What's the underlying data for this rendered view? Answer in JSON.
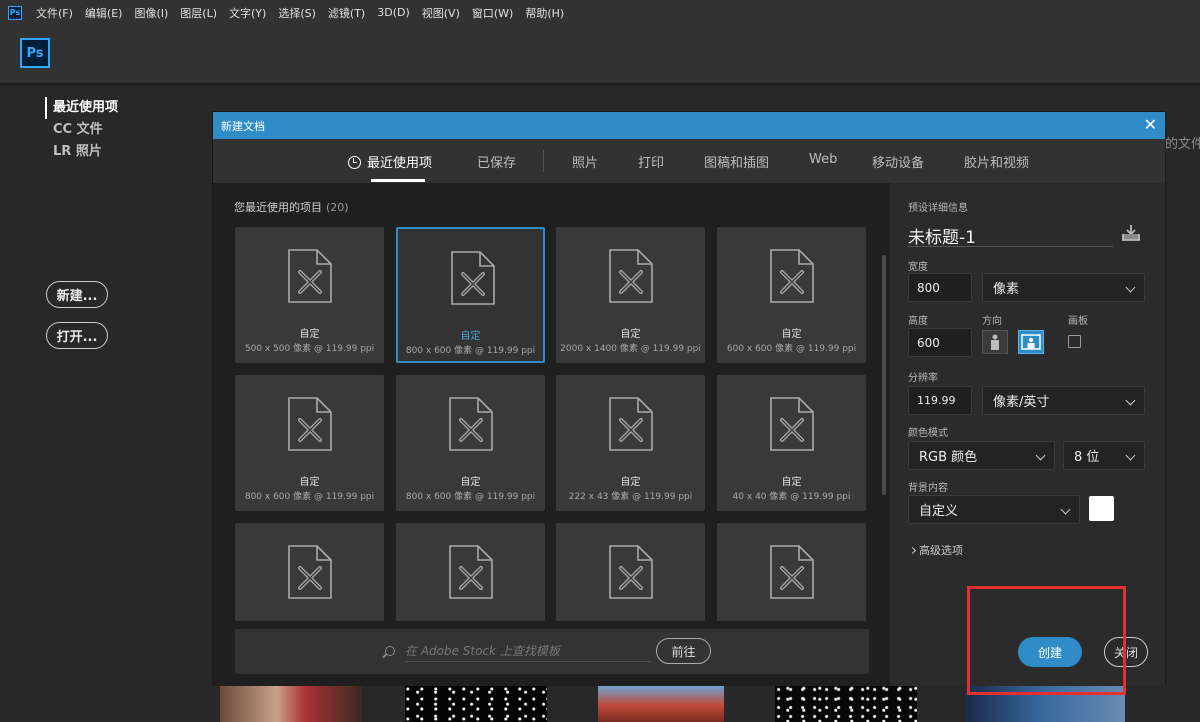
{
  "menubar": {
    "app_icon": "Ps",
    "items": [
      "文件(F)",
      "编辑(E)",
      "图像(I)",
      "图层(L)",
      "文字(Y)",
      "选择(S)",
      "滤镜(T)",
      "3D(D)",
      "视图(V)",
      "窗口(W)",
      "帮助(H)"
    ]
  },
  "home": {
    "logo": "Ps",
    "nav": [
      "最近使用项",
      "CC 文件",
      "LR 照片"
    ],
    "new_button": "新建...",
    "open_button": "打开...",
    "right_hint": "的文件"
  },
  "dialog": {
    "title": "新建文档",
    "tabs": [
      "最近使用项",
      "已保存",
      "照片",
      "打印",
      "图稿和插图",
      "Web",
      "移动设备",
      "胶片和视频"
    ],
    "recent_heading": "您最近使用的项目",
    "recent_count": "(20)",
    "cards": [
      {
        "name": "自定",
        "dims": "500 x 500 像素 @ 119.99 ppi"
      },
      {
        "name": "自定",
        "dims": "800 x 600 像素 @ 119.99 ppi"
      },
      {
        "name": "自定",
        "dims": "2000 x 1400 像素 @ 119.99 ppi"
      },
      {
        "name": "自定",
        "dims": "600 x 600 像素 @ 119.99 ppi"
      },
      {
        "name": "自定",
        "dims": "800 x 600 像素 @ 119.99 ppi"
      },
      {
        "name": "自定",
        "dims": "800 x 600 像素 @ 119.99 ppi"
      },
      {
        "name": "自定",
        "dims": "222 x 43 像素 @ 119.99 ppi"
      },
      {
        "name": "自定",
        "dims": "40 x 40 像素 @ 119.99 ppi"
      },
      {
        "name": "",
        "dims": ""
      },
      {
        "name": "",
        "dims": ""
      },
      {
        "name": "",
        "dims": ""
      },
      {
        "name": "",
        "dims": ""
      }
    ],
    "stock_search_placeholder": "在 Adobe Stock 上查找模板",
    "stock_go": "前往",
    "details": {
      "heading": "预设详细信息",
      "doc_name": "未标题-1",
      "width_label": "宽度",
      "width_value": "800",
      "unit": "像素",
      "height_label": "高度",
      "height_value": "600",
      "orientation_label": "方向",
      "artboard_label": "画板",
      "resolution_label": "分辨率",
      "resolution_value": "119.99",
      "resolution_unit": "像素/英寸",
      "color_mode_label": "颜色模式",
      "color_mode": "RGB 颜色",
      "bit_depth": "8 位",
      "background_label": "背景内容",
      "background": "自定义",
      "advanced": "高级选项"
    },
    "create_button": "创建",
    "close_button": "关闭"
  },
  "colors": {
    "accent": "#2f8cc6",
    "highlight": "#e03030"
  }
}
